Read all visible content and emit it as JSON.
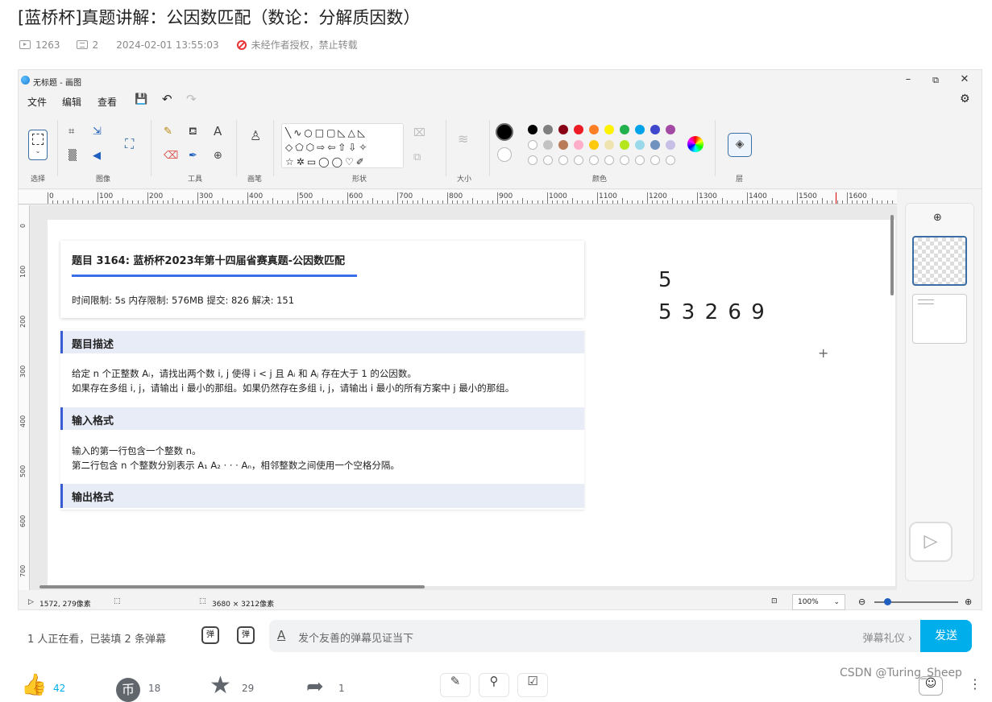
{
  "page": {
    "title": "[蓝桥杯]真题讲解：公因数匹配（数论：分解质因数）",
    "views": "1263",
    "danmaku_count": "2",
    "datetime": "2024-02-01 13:55:03",
    "copyright_notice": "未经作者授权，禁止转载"
  },
  "paint": {
    "window_title": "无标题 - 画图",
    "menu": [
      "文件",
      "编辑",
      "查看"
    ],
    "groups": [
      "选择",
      "图像",
      "工具",
      "画笔",
      "形状",
      "大小",
      "颜色",
      "层"
    ],
    "ruler_labels": [
      "0",
      "100",
      "200",
      "300",
      "400",
      "500",
      "600",
      "700",
      "800",
      "900",
      "1000",
      "1100",
      "1200",
      "1300",
      "1400",
      "1500",
      "1600"
    ],
    "vruler_labels": [
      "0",
      "100",
      "200",
      "300",
      "400",
      "500",
      "600",
      "700"
    ],
    "status": {
      "cursor": "1572, 279像素",
      "canvas_size": "3680 × 3212像素",
      "zoom": "100%"
    },
    "palette_colors": [
      "#000000",
      "#7f7f7f",
      "#880015",
      "#ed1c24",
      "#ff7f27",
      "#fff200",
      "#22b14c",
      "#00a2e8",
      "#3f48cc",
      "#a349a4",
      "#ffffff",
      "#c3c3c3",
      "#b97a57",
      "#ffaec9",
      "#ffc90e",
      "#efe4b0",
      "#b5e61d",
      "#99d9ea",
      "#7092be",
      "#c8bfe7"
    ],
    "primary_color": "#000000",
    "secondary_color": "#ffffff"
  },
  "problem": {
    "title": "题目 3164: 蓝桥杯2023年第十四届省赛真题-公因数匹配",
    "limits": "时间限制: 5s 内存限制: 576MB 提交: 826 解决: 151",
    "desc_head": "题目描述",
    "desc_line1": "给定 n 个正整数 Aᵢ，请找出两个数 i, j 使得 i < j 且 Aᵢ 和 Aⱼ 存在大于 1 的公因数。",
    "desc_line2": "如果存在多组 i, j，请输出 i 最小的那组。如果仍然存在多组 i, j，请输出 i 最小的所有方案中 j 最小的那组。",
    "input_head": "输入格式",
    "input_line1": "输入的第一行包含一个整数 n。",
    "input_line2": "第二行包含 n 个整数分别表示 A₁ A₂ · · · Aₙ，相邻整数之间使用一个空格分隔。",
    "output_head": "输出格式"
  },
  "handwritten": {
    "line1": "5",
    "line2": "5 3 2 6 9"
  },
  "danmaku": {
    "watching": "1 人正在看，已装填 2 条弹幕",
    "placeholder": "发个友善的弹幕见证当下",
    "etiquette": "弹幕礼仪 ›",
    "send": "发送"
  },
  "actions": {
    "like": "42",
    "coin": "18",
    "fav": "29",
    "share": "1"
  },
  "watermark": "CSDN @Turing_Sheep"
}
